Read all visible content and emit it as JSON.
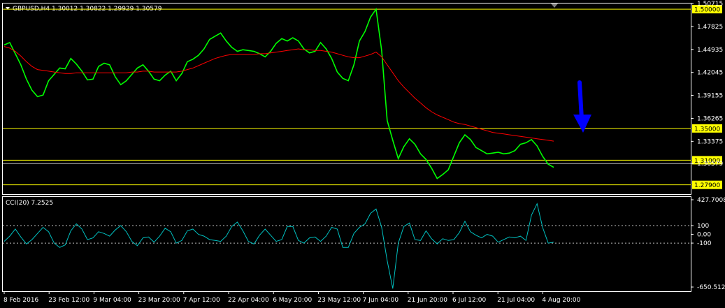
{
  "header": {
    "menu_icon": "triangle-down-icon",
    "symbol_line": "GBPUSD,H4  1.30012 1.30822 1.29929 1.30579",
    "indicator_line": "CCI(20) 7.2525"
  },
  "colors": {
    "price": "#00ff00",
    "moving_average": "#ff0000",
    "level_lines": "#ffff00",
    "cci": "#00c0c0",
    "arrow": "#0000ff",
    "tag_bg": "#ffff00"
  },
  "annotation": {
    "arrow_icon": "arrow-down-icon",
    "direction": "down"
  },
  "chart_data": [
    {
      "type": "line",
      "title": "GBPUSD,H4",
      "ylim": [
        1.2673,
        1.50715
      ],
      "price_ticks": [
        "1.50715",
        "1.47825",
        "1.44935",
        "1.42045",
        "1.39155",
        "1.36265",
        "1.33375",
        "1.30579"
      ],
      "price_tick_values": [
        1.50715,
        1.47825,
        1.44935,
        1.42045,
        1.39155,
        1.36265,
        1.33375,
        1.30579
      ],
      "current_price": "1.30579",
      "levels": [
        {
          "label": "1.50000",
          "value": 1.5
        },
        {
          "label": "1.35000",
          "value": 1.35
        },
        {
          "label": "1.31000",
          "value": 1.31
        },
        {
          "label": "1.27900",
          "value": 1.279
        }
      ],
      "x_labels": [
        "8 Feb 2016",
        "23 Feb 12:00",
        "9 Mar 04:00",
        "23 Mar 20:00",
        "7 Apr 12:00",
        "22 Apr 04:00",
        "6 May 20:00",
        "23 May 12:00",
        "7 Jun 04:00",
        "21 Jun 20:00",
        "6 Jul 12:00",
        "21 Jul 04:00",
        "4 Aug 20:00"
      ],
      "series": [
        {
          "values": [
            1.455,
            1.458,
            1.444,
            1.43,
            1.412,
            1.398,
            1.39,
            1.392,
            1.41,
            1.418,
            1.426,
            1.425,
            1.438,
            1.431,
            1.422,
            1.411,
            1.412,
            1.428,
            1.432,
            1.43,
            1.415,
            1.405,
            1.41,
            1.418,
            1.426,
            1.43,
            1.422,
            1.412,
            1.41,
            1.417,
            1.422,
            1.41,
            1.419,
            1.434,
            1.437,
            1.442,
            1.45,
            1.462,
            1.466,
            1.47,
            1.46,
            1.452,
            1.447,
            1.449,
            1.448,
            1.447,
            1.444,
            1.44,
            1.447,
            1.457,
            1.463,
            1.46,
            1.464,
            1.46,
            1.45,
            1.445,
            1.447,
            1.458,
            1.45,
            1.438,
            1.421,
            1.413,
            1.41,
            1.43,
            1.46,
            1.472,
            1.49,
            1.5,
            1.448,
            1.36,
            1.335,
            1.312,
            1.327,
            1.337,
            1.33,
            1.318,
            1.311,
            1.3,
            1.287,
            1.292,
            1.298,
            1.315,
            1.332,
            1.342,
            1.336,
            1.326,
            1.322,
            1.318,
            1.319,
            1.32,
            1.318,
            1.319,
            1.322,
            1.33,
            1.332,
            1.336,
            1.328,
            1.315,
            1.305,
            1.301
          ]
        },
        {
          "values": [
            1.453,
            1.451,
            1.447,
            1.441,
            1.434,
            1.428,
            1.424,
            1.423,
            1.422,
            1.421,
            1.42,
            1.419,
            1.419,
            1.42,
            1.42,
            1.42,
            1.42,
            1.42,
            1.42,
            1.42,
            1.42,
            1.42,
            1.42,
            1.421,
            1.421,
            1.422,
            1.422,
            1.421,
            1.421,
            1.421,
            1.421,
            1.421,
            1.422,
            1.424,
            1.426,
            1.429,
            1.432,
            1.435,
            1.438,
            1.44,
            1.442,
            1.443,
            1.443,
            1.443,
            1.443,
            1.443,
            1.444,
            1.444,
            1.445,
            1.446,
            1.447,
            1.448,
            1.449,
            1.45,
            1.449,
            1.449,
            1.448,
            1.448,
            1.447,
            1.446,
            1.444,
            1.442,
            1.44,
            1.439,
            1.439,
            1.441,
            1.443,
            1.446,
            1.44,
            1.43,
            1.42,
            1.41,
            1.402,
            1.395,
            1.388,
            1.382,
            1.376,
            1.371,
            1.367,
            1.364,
            1.361,
            1.358,
            1.356,
            1.355,
            1.353,
            1.351,
            1.349,
            1.347,
            1.345,
            1.344,
            1.343,
            1.342,
            1.341,
            1.34,
            1.339,
            1.338,
            1.337,
            1.336,
            1.335,
            1.334
          ]
        }
      ]
    },
    {
      "type": "line",
      "title": "CCI(20) 7.2525",
      "ylim": [
        -650.5122,
        427.7008
      ],
      "y_ticks": [
        "427.7008",
        "100",
        "0.00",
        "-100",
        "-650.5122"
      ],
      "y_tick_values": [
        427.7008,
        100,
        0,
        -100,
        -650.5122
      ],
      "levels": [
        100,
        -100
      ],
      "series": [
        {
          "values": [
            -80,
            -20,
            60,
            -30,
            -110,
            -60,
            10,
            80,
            30,
            -100,
            -150,
            -120,
            40,
            120,
            60,
            -60,
            -40,
            30,
            10,
            -20,
            50,
            100,
            30,
            -80,
            -130,
            -40,
            -30,
            -90,
            -20,
            70,
            30,
            -100,
            -70,
            40,
            60,
            0,
            -20,
            -60,
            -70,
            -80,
            -20,
            90,
            140,
            40,
            -80,
            -110,
            -10,
            60,
            -10,
            -80,
            -60,
            90,
            90,
            -70,
            -100,
            -40,
            -30,
            -80,
            -20,
            80,
            60,
            -150,
            -150,
            10,
            80,
            120,
            240,
            290,
            80,
            -300,
            -620,
            -100,
            90,
            130,
            -60,
            -70,
            40,
            -50,
            -110,
            -50,
            -70,
            -60,
            20,
            150,
            30,
            -10,
            -40,
            0,
            -20,
            -90,
            -60,
            -30,
            -40,
            -20,
            -70,
            220,
            350,
            80,
            -100,
            -90
          ]
        }
      ]
    }
  ]
}
